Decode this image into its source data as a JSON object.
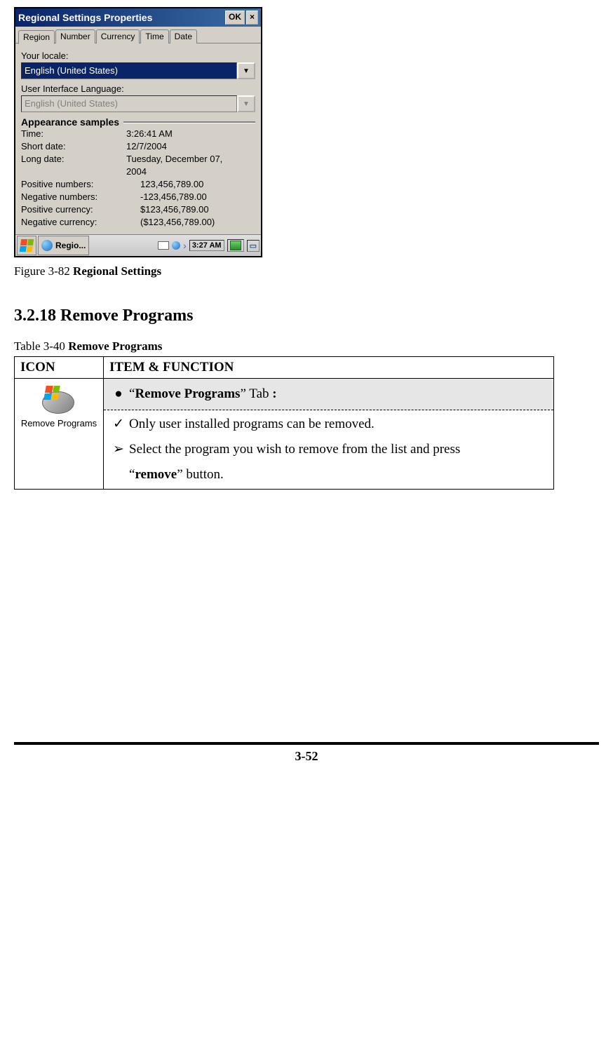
{
  "screenshot": {
    "title": "Regional Settings Properties",
    "ok": "OK",
    "close": "×",
    "tabs": [
      "Region",
      "Number",
      "Currency",
      "Time",
      "Date"
    ],
    "locale_label": "Your locale:",
    "locale_value": "English (United States)",
    "ui_lang_label": "User Interface Language:",
    "ui_lang_value": "English (United States)",
    "samples_title": "Appearance samples",
    "rows": {
      "time_l": "Time:",
      "time_v": "3:26:41 AM",
      "sdate_l": "Short date:",
      "sdate_v": "12/7/2004",
      "ldate_l": "Long date:",
      "ldate_v1": "Tuesday, December 07,",
      "ldate_v2": "2004",
      "pnum_l": "Positive numbers:",
      "pnum_v": "123,456,789.00",
      "nnum_l": "Negative numbers:",
      "nnum_v": "-123,456,789.00",
      "pcur_l": "Positive currency:",
      "pcur_v": "$123,456,789.00",
      "ncur_l": "Negative currency:",
      "ncur_v": "($123,456,789.00)"
    },
    "taskbar": {
      "app": "Regio...",
      "clock": "3:27 AM"
    }
  },
  "figure_caption_prefix": "Figure 3-82 ",
  "figure_caption_bold": "Regional Settings",
  "section_heading": "3.2.18 Remove Programs",
  "table_caption_prefix": "Table 3-40 ",
  "table_caption_bold": "Remove Programs",
  "table": {
    "h_icon": "ICON",
    "h_item": "ITEM & FUNCTION",
    "icon_label": "Remove Programs",
    "row_tab_q1": "“",
    "row_tab_bold": "Remove Programs",
    "row_tab_q2": "” Tab",
    "row_tab_colon": " :",
    "row_only": "Only user installed programs can be removed.",
    "row_select_a": "Select the program you wish to remove from the list and press",
    "row_select_q1": "“",
    "row_select_bold": "remove",
    "row_select_q2": "” button."
  },
  "page_number": "3-52"
}
